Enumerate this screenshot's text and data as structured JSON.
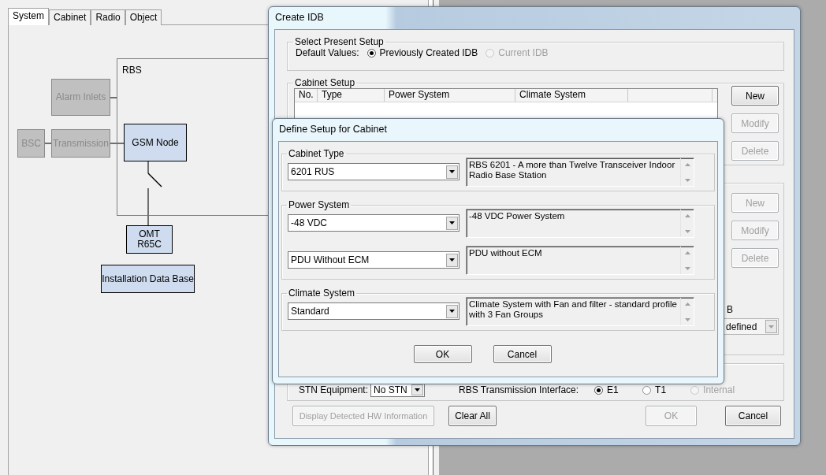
{
  "main_window": {
    "tabs": [
      {
        "label": "System",
        "selected": true
      },
      {
        "label": "Cabinet",
        "selected": false
      },
      {
        "label": "Radio",
        "selected": false
      },
      {
        "label": "Object",
        "selected": false
      }
    ],
    "diagram": {
      "container_label": "RBS",
      "nodes": [
        {
          "label": "Alarm Inlets",
          "disabled": true
        },
        {
          "label": "BSC",
          "disabled": true
        },
        {
          "label": "Transmission",
          "disabled": true
        },
        {
          "label": "GSM Node",
          "disabled": false
        },
        {
          "label": "OMT\nR65C",
          "disabled": false
        },
        {
          "label": "Installation Data Base",
          "disabled": false
        }
      ]
    }
  },
  "create_idb": {
    "title": "Create IDB",
    "select_present_setup": {
      "title": "Select Present Setup",
      "label": "Default Values:",
      "options": [
        {
          "label": "Previously Created IDB",
          "selected": true,
          "disabled": false
        },
        {
          "label": "Current IDB",
          "selected": false,
          "disabled": true
        }
      ]
    },
    "cabinet_setup": {
      "title": "Cabinet Setup",
      "columns": [
        "No.",
        "Type",
        "Power System",
        "Climate System"
      ],
      "buttons": [
        {
          "label": "New",
          "disabled": false
        },
        {
          "label": "Modify",
          "disabled": true
        },
        {
          "label": "Delete",
          "disabled": true
        }
      ]
    },
    "second_group": {
      "buttons": [
        {
          "label": "New",
          "disabled": true
        },
        {
          "label": "Modify",
          "disabled": true
        },
        {
          "label": "Delete",
          "disabled": true
        }
      ],
      "partial_label": "B",
      "dropdown_value": "defined"
    },
    "transmission": {
      "stn_label": "STN Equipment:",
      "stn_value": "No STN",
      "interface_label": "RBS Transmission Interface:",
      "options": [
        {
          "label": "E1",
          "selected": true,
          "disabled": false
        },
        {
          "label": "T1",
          "selected": false,
          "disabled": false
        },
        {
          "label": "Internal",
          "selected": false,
          "disabled": true
        }
      ]
    },
    "buttons": [
      {
        "label": "Display Detected HW Information",
        "disabled": true
      },
      {
        "label": "Clear All",
        "disabled": false
      },
      {
        "label": "OK",
        "disabled": true
      },
      {
        "label": "Cancel",
        "disabled": false
      }
    ]
  },
  "define_setup": {
    "title": "Define Setup for Cabinet",
    "groups": [
      {
        "title": "Cabinet Type",
        "rows": [
          {
            "value": "6201 RUS",
            "description": "RBS 6201 - A more than Twelve Transceiver Indoor Radio Base Station"
          }
        ]
      },
      {
        "title": "Power System",
        "rows": [
          {
            "value": "-48 VDC",
            "description": "-48 VDC Power System"
          },
          {
            "value": "PDU Without ECM",
            "description": "PDU without ECM"
          }
        ]
      },
      {
        "title": "Climate System",
        "rows": [
          {
            "value": "Standard",
            "description": "Climate System with Fan and filter - standard profile with 3 Fan Groups"
          }
        ]
      }
    ],
    "buttons": [
      "OK",
      "Cancel"
    ]
  }
}
